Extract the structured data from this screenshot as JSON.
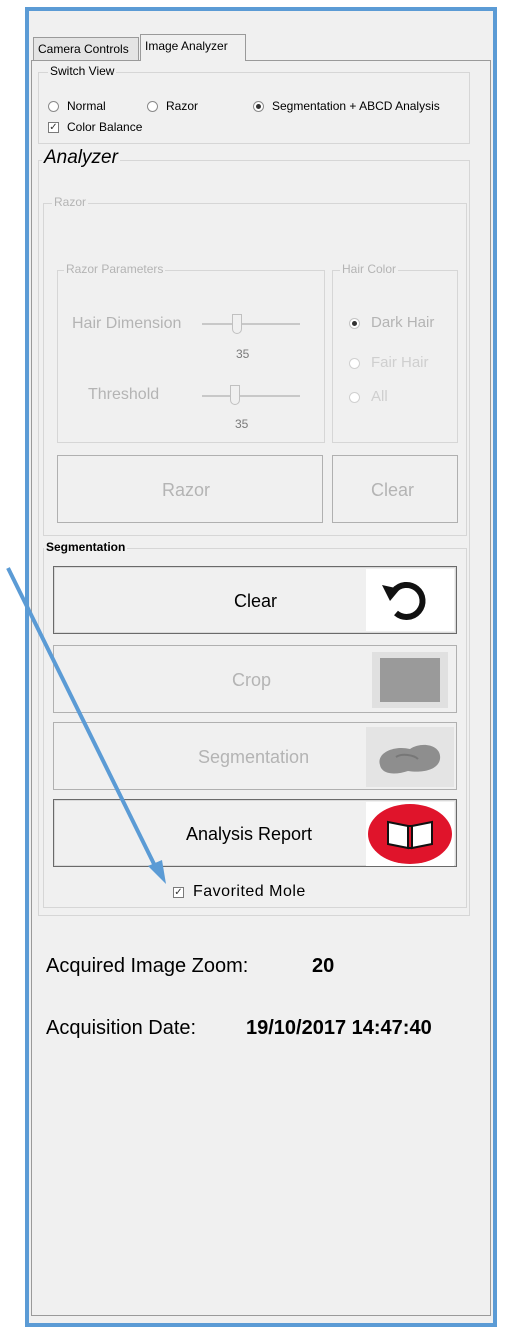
{
  "tabs": [
    {
      "label": "Camera Controls"
    },
    {
      "label": "Image Analyzer"
    }
  ],
  "switch_view": {
    "title": "Switch View",
    "options": [
      {
        "label": "Normal",
        "selected": false
      },
      {
        "label": "Razor",
        "selected": false
      },
      {
        "label": "Segmentation + ABCD Analysis",
        "selected": true
      }
    ],
    "color_balance": {
      "label": "Color Balance",
      "checked": true
    }
  },
  "analyzer": {
    "title": "Analyzer",
    "razor": {
      "title": "Razor",
      "parameters": {
        "title": "Razor Parameters",
        "hair_dimension": {
          "label": "Hair Dimension",
          "value": "35"
        },
        "threshold": {
          "label": "Threshold",
          "value": "35"
        }
      },
      "hair_color": {
        "title": "Hair Color",
        "options": [
          {
            "label": "Dark Hair",
            "selected": true
          },
          {
            "label": "Fair Hair",
            "selected": false
          },
          {
            "label": "All",
            "selected": false
          }
        ]
      },
      "razor_button": "Razor",
      "clear_button": "Clear"
    },
    "segmentation": {
      "title": "Segmentation",
      "buttons": [
        {
          "label": "Clear",
          "icon": "undo-icon"
        },
        {
          "label": "Crop",
          "icon": "crop-icon"
        },
        {
          "label": "Segmentation",
          "icon": "segmentation-icon"
        },
        {
          "label": "Analysis Report",
          "icon": "book-icon"
        }
      ],
      "favorited": {
        "label": "Favorited Mole",
        "checked": true
      }
    }
  },
  "info": {
    "zoom_label": "Acquired Image Zoom:",
    "zoom_value": "20",
    "date_label": "Acquisition Date:",
    "date_value": "19/10/2017 14:47:40"
  },
  "colors": {
    "frame_border": "#5b9bd5",
    "arrow": "#5b9bd5",
    "book_icon_bg": "#e0142b",
    "disabled_text": "#b4b4b4"
  }
}
